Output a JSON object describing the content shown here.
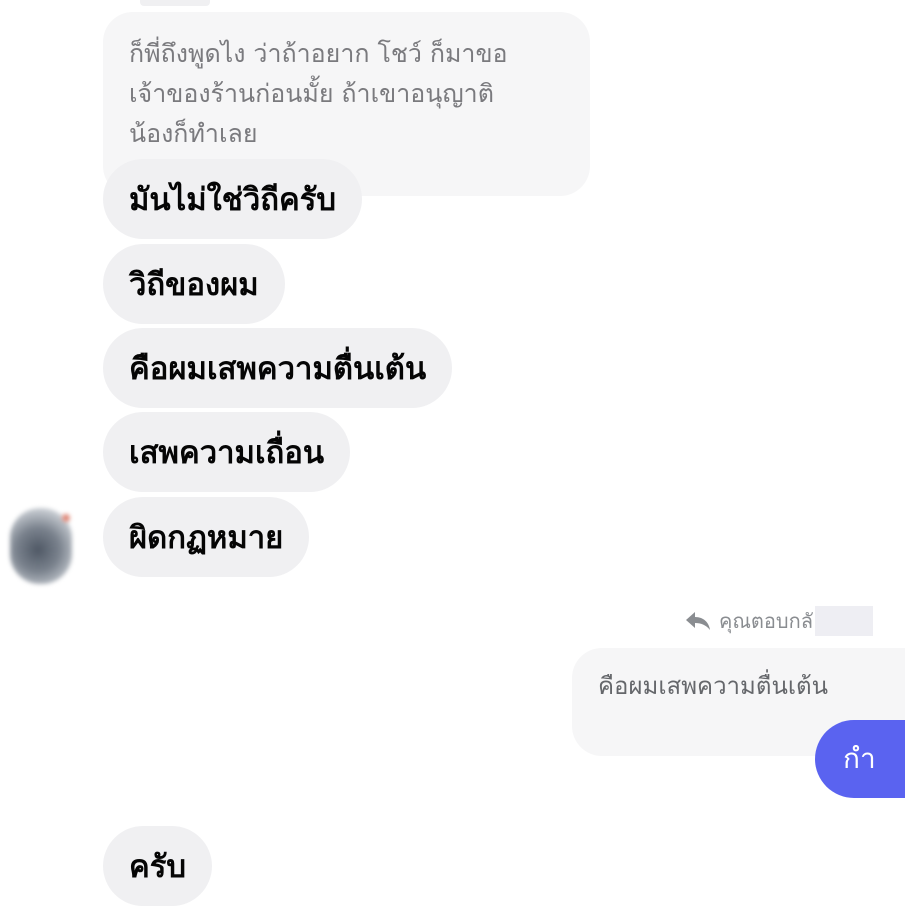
{
  "conversation": {
    "quoted_message": {
      "lines": [
        "ก็พี่ถึงพูดไง ว่าถ้าอยาก โชว์ ก็มาขอ",
        "เจ้าของร้านก่อนมั้ย ถ้าเขาอนุญาติ",
        "น้องก็ทำเลย"
      ]
    },
    "received_messages": [
      "มันไม่ใช่วิถีครับ",
      "วิถีของผม",
      "คือผมเสพความตื่นเต้น",
      "เสพความเถื่อน",
      "ผิดกฏหมาย"
    ],
    "reply": {
      "header": "คุณตอบกลั",
      "quoted_text": "คือผมเสพความตื่นเต้น",
      "sent_text": "กำ"
    },
    "final_message": "ครับ"
  },
  "colors": {
    "received_bubble": "#f0f0f2",
    "quoted_bubble": "#f6f6f7",
    "sent_bubble": "#5a63f0",
    "muted_text": "#8a8d91"
  },
  "icons": {
    "reply_icon": "reply-arrow"
  }
}
